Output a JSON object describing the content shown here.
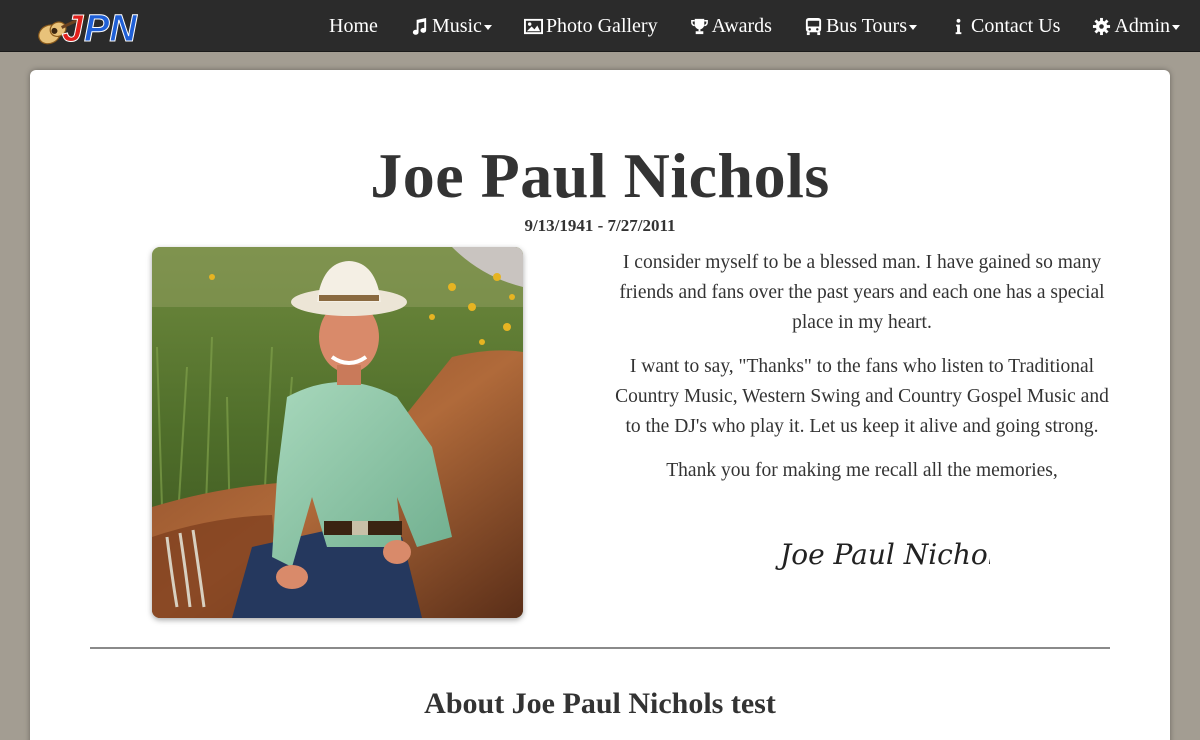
{
  "logo": {
    "text": "JPN",
    "icon": "guitar-icon"
  },
  "nav": {
    "items": [
      {
        "label": "Home",
        "icon": "",
        "dropdown": false
      },
      {
        "label": "Music",
        "icon": "music-note-icon",
        "dropdown": true
      },
      {
        "label": "Photo Gallery",
        "icon": "image-icon",
        "dropdown": false
      },
      {
        "label": "Awards",
        "icon": "trophy-icon",
        "dropdown": false
      },
      {
        "label": "Bus Tours",
        "icon": "bus-icon",
        "dropdown": true
      },
      {
        "label": "Contact Us",
        "icon": "info-icon",
        "dropdown": false
      },
      {
        "label": "Admin",
        "icon": "gear-icon",
        "dropdown": true
      }
    ]
  },
  "hero": {
    "title": "Joe Paul Nichols",
    "dates": "9/13/1941 - 7/27/2011"
  },
  "message": {
    "paragraphs": [
      "I consider myself to be a blessed man. I have gained so many friends and fans over the past years and each one has a special place in my heart.",
      "I want to say, \"Thanks\" to the fans who listen to Traditional Country Music, Western Swing and Country Gospel Music and to the DJ's who play it. Let us keep it alive and going strong.",
      "Thank you for making me recall all the memories,"
    ],
    "signature": "Joe Paul Nichols"
  },
  "about": {
    "heading": "About Joe Paul Nichols test"
  },
  "colors": {
    "navbar": "#2b2b2b",
    "page_background": "#a39d92",
    "card": "#ffffff",
    "text": "#333333",
    "logo_red": "#e0201c",
    "logo_blue": "#1f5fd6"
  }
}
